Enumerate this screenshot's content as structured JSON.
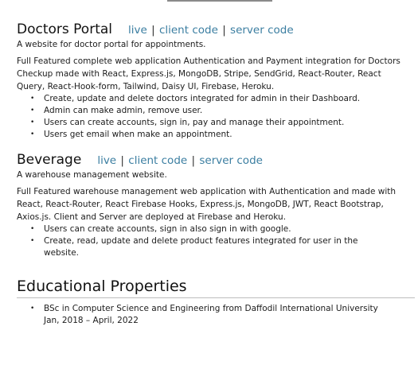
{
  "projects": [
    {
      "title": "Doctors Portal",
      "links": [
        "live",
        "client code",
        "server code"
      ],
      "separator": "|",
      "subtitle": "A website for doctor portal for appointments.",
      "description": "Full Featured complete web application Authentication and Payment integration for Doctors Checkup made with React, Express.js, MongoDB, Stripe, SendGrid, React-Router, React Query, React-Hook-form, Tailwind, Daisy UI, Firebase, Heroku.",
      "bullets": [
        "Create, update and delete doctors integrated for admin in their Dashboard.",
        "Admin can make admin, remove user.",
        "Users can create accounts, sign in, pay and manage their appointment.",
        "Users get email when make an appointment."
      ]
    },
    {
      "title": "Beverage",
      "links": [
        "live",
        "client code",
        "server code"
      ],
      "separator": "|",
      "subtitle": "A warehouse management website.",
      "description": "Full Featured warehouse management web application with Authentication and made with React, React-Router, React Firebase Hooks, Express.js, MongoDB, JWT, React Bootstrap, Axios.js. Client and Server are deployed at Firebase and Heroku.",
      "bullets": [
        "Users can create accounts, sign in also sign in with google.",
        "Create, read, update and delete product features integrated for user in the website."
      ]
    }
  ],
  "education": {
    "heading": "Educational Properties",
    "items": [
      "BSc in Computer Science and Engineering from Daffodil International University Jan, 2018 – April, 2022"
    ]
  },
  "bullet_glyph": "•",
  "colors": {
    "link": "#3b7ea1",
    "text": "#1c1c1c",
    "rule": "#bdbdbd"
  }
}
